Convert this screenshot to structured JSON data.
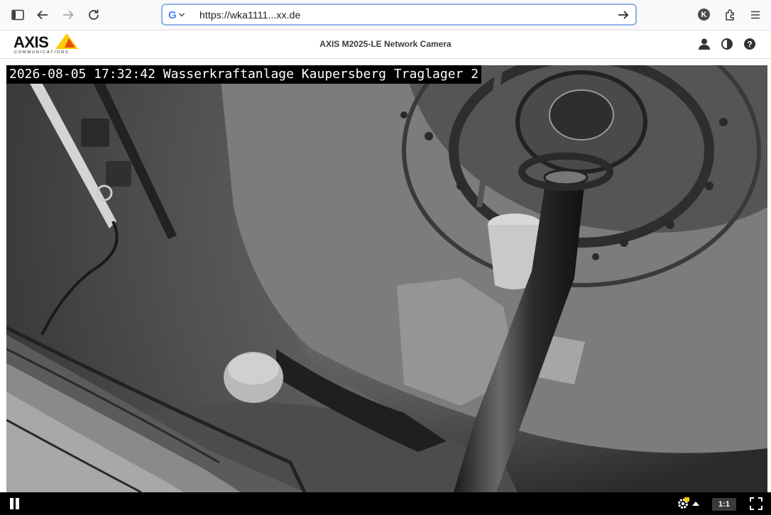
{
  "browser": {
    "url": "https://wka1111...xx.de",
    "search_engine_letter": "G",
    "profile_initial": "K",
    "icons": [
      "sidebar-toggle-icon",
      "back-arrow-icon",
      "forward-arrow-icon",
      "reload-icon",
      "go-arrow-icon",
      "extensions-icon",
      "menu-icon"
    ]
  },
  "camera": {
    "logo": "AXIS",
    "logo_sub": "COMMUNICATIONS",
    "title": "AXIS M2025-LE Network Camera",
    "header_icons": [
      "user-icon",
      "contrast-icon",
      "help-icon"
    ]
  },
  "video": {
    "overlay_text": "2026-08-05 17:32:42 Wasserkraftanlage Kaupersberg Traglager 2",
    "scene": "night-mode grayscale view inside turbine shaft"
  },
  "controls": {
    "ratio_label": "1:1",
    "icons": [
      "pause-icon",
      "settings-icon",
      "chevron-up-icon",
      "fullscreen-icon"
    ]
  },
  "colors": {
    "url_focus_border": "#8fb2e6",
    "axis_yellow": "#ffcc00",
    "control_bar": "#000000"
  }
}
